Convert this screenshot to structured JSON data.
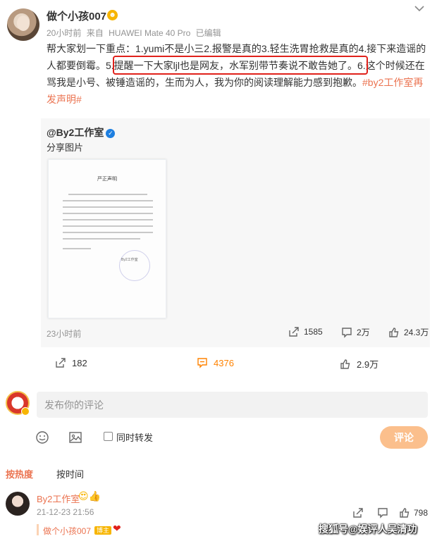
{
  "post": {
    "username": "做个小孩007",
    "badge": "😍",
    "time": "20小时前",
    "source_prefix": "来自",
    "source": "HUAWEI Mate 40 Pro",
    "edited": "已编辑",
    "text_part1": "帮大家划一下重点：1.yumi不是小三2.报警是真的3.轻生洗胃抢救是真的4.接下来造谣的人都要倒霉。",
    "text_highlight": "5.提醒一下大家ljl也是网友，水军别带节奏说不敢告她了。",
    "text_part2": "6.这个时候还在骂我是小号、被锤造谣的，生而为人，我为你的阅读理解能力感到抱歉。",
    "hashtag": "#by2工作室再发声明#"
  },
  "repost": {
    "username": "@By2工作室",
    "verified_icon": "✓",
    "text": "分享图片",
    "doc_title": "严正声明",
    "doc_sig": "By2工作室",
    "time": "23小时前",
    "reposts": "1585",
    "comments": "2万",
    "likes": "24.3万"
  },
  "actions": {
    "reposts": "182",
    "comments": "4376",
    "likes": "2.9万",
    "active_color": "#ff8200"
  },
  "compose": {
    "placeholder": "发布你的评论",
    "also_repost_label": "同时转发",
    "submit_label": "评论"
  },
  "sort": {
    "by_hot": "按热度",
    "by_time": "按时间"
  },
  "top_comment": {
    "username": "By2工作室",
    "emoji": "😍👍",
    "time": "21-12-23 21:56",
    "likes": "798",
    "reply_user": "做个小孩007",
    "reply_tag": "博主",
    "reply_emoji": "❤"
  },
  "watermark": "搜狐号@娱评人吴清功"
}
